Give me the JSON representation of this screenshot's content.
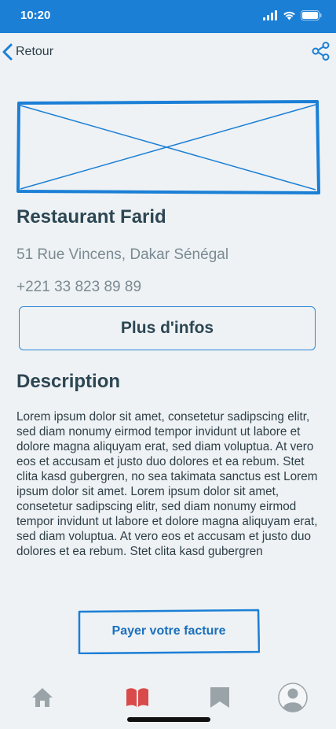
{
  "status_bar": {
    "time": "10:20"
  },
  "nav": {
    "back_label": "Retour"
  },
  "restaurant": {
    "name": "Restaurant Farid",
    "address": "51 Rue Vincens, Dakar Sénégal",
    "phone": "+221 33 823 89 89"
  },
  "more_info_label": "Plus d'infos",
  "description": {
    "title": "Description",
    "text": "Lorem ipsum dolor sit amet, consetetur sadipscing elitr, sed diam nonumy eirmod tempor invidunt ut labore et dolore magna aliquyam erat, sed diam voluptua. At vero eos et accusam et justo duo dolores et ea rebum. Stet clita kasd gubergren, no sea takimata sanctus est Lorem ipsum dolor sit amet. Lorem ipsum dolor sit amet, consetetur sadipscing elitr, sed diam nonumy eirmod tempor invidunt ut labore et dolore magna aliquyam erat, sed diam voluptua. At vero eos et accusam et justo duo dolores et ea rebum. Stet clita kasd gubergren"
  },
  "pay_button_label": "Payer votre facture",
  "tab_bar": {
    "tabs": [
      {
        "icon": "home-icon",
        "active": false
      },
      {
        "icon": "book-icon",
        "active": true
      },
      {
        "icon": "bookmark-icon",
        "active": false
      },
      {
        "icon": "user-icon",
        "active": false
      }
    ]
  },
  "colors": {
    "accent": "#1b7fd6",
    "background": "#eef2f4",
    "active_tab": "#d94a4a",
    "inactive_tab": "#9aa3a8"
  }
}
